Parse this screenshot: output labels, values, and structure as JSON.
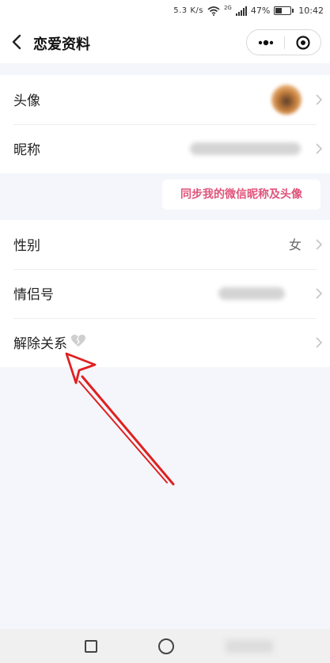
{
  "status_bar": {
    "speed": "5.3 K/s",
    "network": "2G",
    "battery": "47%",
    "time": "10:42"
  },
  "header": {
    "title": "恋爱资料"
  },
  "profile": {
    "avatar_label": "头像",
    "nickname_label": "昵称",
    "sync_button": "同步我的微信昵称及头像",
    "gender_label": "性别",
    "gender_value": "女",
    "couple_id_label": "情侣号",
    "unbind_label": "解除关系"
  },
  "colors": {
    "accent_pink": "#e0537a",
    "annotation_red": "#e02020",
    "background": "#f4f6fb"
  },
  "icons": [
    "back-arrow-icon",
    "more-dots-icon",
    "close-target-icon",
    "chevron-right-icon",
    "broken-heart-icon",
    "wifi-icon",
    "signal-icon",
    "battery-icon"
  ]
}
